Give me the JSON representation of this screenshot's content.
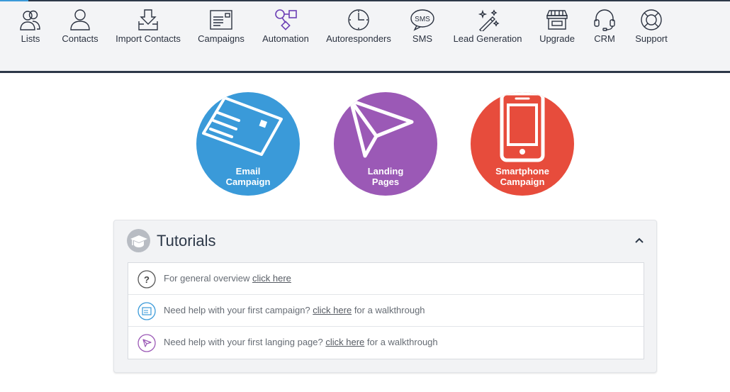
{
  "nav": {
    "items": [
      {
        "label": "Lists",
        "icon": "users-group-icon"
      },
      {
        "label": "Contacts",
        "icon": "user-icon"
      },
      {
        "label": "Import Contacts",
        "icon": "import-icon"
      },
      {
        "label": "Campaigns",
        "icon": "campaign-icon"
      },
      {
        "label": "Automation",
        "icon": "automation-icon"
      },
      {
        "label": "Autoresponders",
        "icon": "clock-icon"
      },
      {
        "label": "SMS",
        "icon": "sms-icon"
      },
      {
        "label": "Lead Generation",
        "icon": "magic-wand-icon"
      },
      {
        "label": "Upgrade",
        "icon": "store-icon"
      },
      {
        "label": "CRM",
        "icon": "headset-icon"
      },
      {
        "label": "Support",
        "icon": "lifebuoy-icon"
      }
    ],
    "sms_icon_text": "SMS"
  },
  "quick_actions": {
    "email": {
      "line1": "Email",
      "line2": "Campaign",
      "color": "#3a9ad9"
    },
    "landing": {
      "line1": "Landing",
      "line2": "Pages",
      "color": "#9b59b6"
    },
    "smartphone": {
      "line1": "Smartphone",
      "line2": "Campaign",
      "color": "#e74c3c"
    }
  },
  "tutorials": {
    "title": "Tutorials",
    "rows": [
      {
        "prefix": "For general overview ",
        "link": "click here",
        "suffix": ""
      },
      {
        "prefix": "Need help with your first campaign? ",
        "link": "click here",
        "suffix": " for a walkthrough"
      },
      {
        "prefix": "Need help with your first langing page? ",
        "link": "click here",
        "suffix": " for a walkthrough"
      }
    ]
  },
  "colors": {
    "nav_bg": "#f3f4f6",
    "nav_border": "#2d3848",
    "automation_accent": "#6c3fb5"
  }
}
